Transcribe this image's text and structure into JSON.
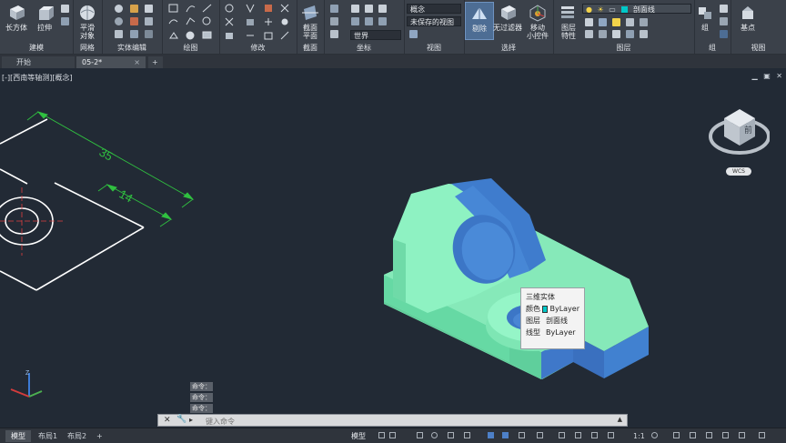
{
  "ribbon": {
    "panels": {
      "modeling": "建模",
      "mesh": "网格",
      "solid_editing": "实体编辑",
      "draw": "绘图",
      "modify": "修改",
      "section": "截面",
      "coordinates": "坐标",
      "view": "视图",
      "selection": "选择",
      "layers": "图层",
      "groups": "组",
      "view2": "视图"
    },
    "buttons": {
      "box": "长方体",
      "extrude": "拉伸",
      "smooth_object": "平滑\n对象",
      "section_plane": "截面\n平面",
      "culling": "剔除",
      "no_filter": "无过滤器",
      "move_gizmo": "移动\n小控件",
      "layer_properties": "图层\n特性",
      "group": "组",
      "base_point": "基点"
    },
    "visual_style": "概念",
    "unsaved_view": "未保存的视图",
    "ucs_world": "世界",
    "layer_current": "剖面线",
    "layer_color": "#00c8c8"
  },
  "tabs": {
    "start": "开始",
    "drawing": "05-2*",
    "add": "+"
  },
  "viewport": {
    "label": "[-][西南等轴测][概念]",
    "dim_35": "35",
    "dim_14": "14",
    "viewcube_face": "前",
    "wcs": "WCS"
  },
  "tooltip": {
    "title": "三维实体",
    "rows": [
      {
        "key": "颜色",
        "value": "ByLayer"
      },
      {
        "key": "图层",
        "value": "剖面线"
      },
      {
        "key": "线型",
        "value": "ByLayer"
      }
    ],
    "swatch_color": "#00c8c8"
  },
  "command": {
    "history": [
      "命令：",
      "命令：",
      "命令："
    ],
    "placeholder": "键入命令"
  },
  "status": {
    "tabs": [
      "模型",
      "布局1",
      "布局2"
    ],
    "add": "+",
    "model_space": "模型",
    "scale": "1:1"
  }
}
